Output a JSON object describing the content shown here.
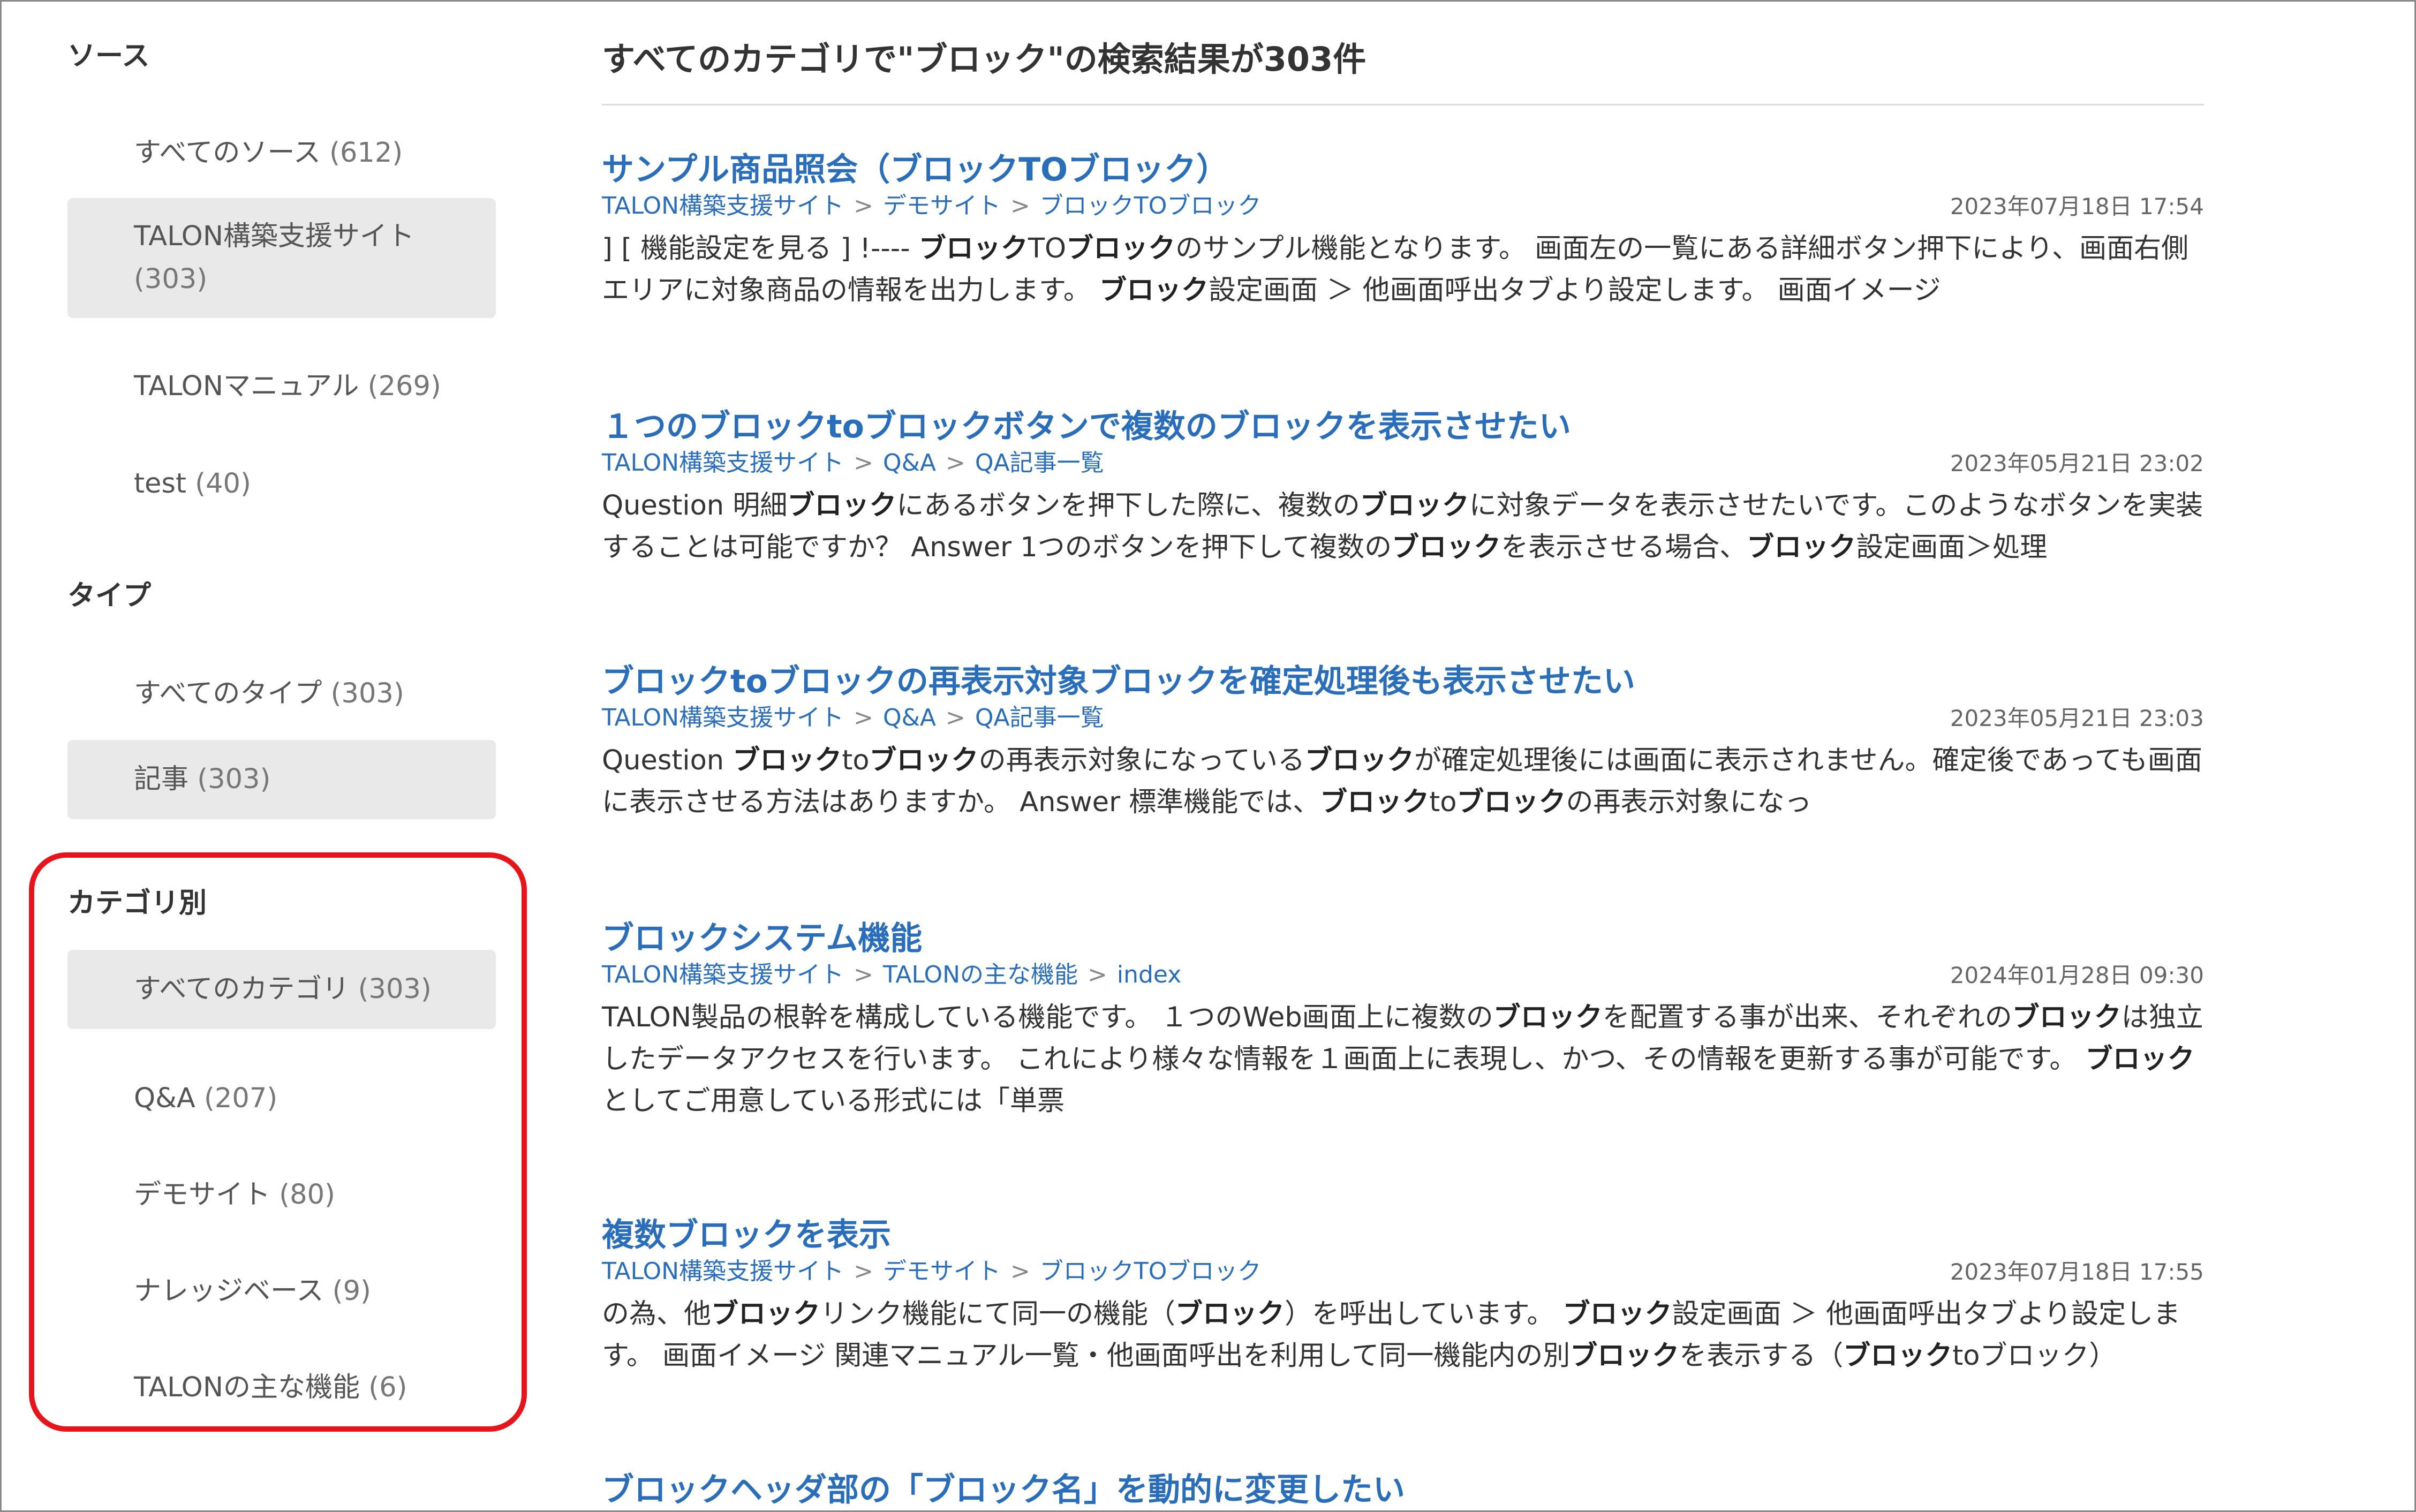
{
  "sidebar": {
    "source": {
      "heading": "ソース",
      "items": [
        {
          "label": "すべてのソース",
          "count": "(612)"
        },
        {
          "label": "TALON構築支援サイト",
          "count": "(303)"
        },
        {
          "label": "TALONマニュアル",
          "count": "(269)"
        },
        {
          "label": "test",
          "count": "(40)"
        }
      ]
    },
    "type": {
      "heading": "タイプ",
      "items": [
        {
          "label": "すべてのタイプ",
          "count": "(303)"
        },
        {
          "label": "記事",
          "count": "(303)"
        }
      ]
    },
    "category": {
      "heading": "カテゴリ別",
      "items": [
        {
          "label": "すべてのカテゴリ",
          "count": "(303)"
        },
        {
          "label": "Q&A",
          "count": "(207)"
        },
        {
          "label": "デモサイト",
          "count": "(80)"
        },
        {
          "label": "ナレッジベース",
          "count": "(9)"
        },
        {
          "label": "TALONの主な機能",
          "count": "(6)"
        }
      ]
    }
  },
  "main": {
    "header": "すべてのカテゴリで\"ブロック\"の検索結果が303件",
    "results": [
      {
        "title": "サンプル商品照会（ブロックTOブロック）",
        "breadcrumb": [
          "TALON構築支援サイト",
          "デモサイト",
          "ブロックTOブロック"
        ],
        "date": "2023年07月18日 17:54",
        "snippet": [
          {
            "t": "] [ 機能設定を見る ] !---- "
          },
          {
            "t": "ブロック",
            "b": true
          },
          {
            "t": "TO"
          },
          {
            "t": "ブロック",
            "b": true
          },
          {
            "t": "のサンプル機能となります。 画面左の一覧にある詳細ボタン押下により、画面右側エリアに対象商品の情報を出力します。 "
          },
          {
            "t": "ブロック",
            "b": true
          },
          {
            "t": "設定画面 ＞ 他画面呼出タブより設定します。 画面イメージ"
          }
        ]
      },
      {
        "title": "１つのブロックtoブロックボタンで複数のブロックを表示させたい",
        "breadcrumb": [
          "TALON構築支援サイト",
          "Q&A",
          "QA記事一覧"
        ],
        "date": "2023年05月21日 23:02",
        "snippet": [
          {
            "t": "Question 明細"
          },
          {
            "t": "ブロック",
            "b": true
          },
          {
            "t": "にあるボタンを押下した際に、複数の"
          },
          {
            "t": "ブロック",
            "b": true
          },
          {
            "t": "に対象データを表示させたいです。このようなボタンを実装することは可能ですか？ Answer 1つのボタンを押下して複数の"
          },
          {
            "t": "ブロック",
            "b": true
          },
          {
            "t": "を表示させる場合、"
          },
          {
            "t": "ブロック",
            "b": true
          },
          {
            "t": "設定画面＞処理"
          }
        ]
      },
      {
        "title": "ブロックtoブロックの再表示対象ブロックを確定処理後も表示させたい",
        "breadcrumb": [
          "TALON構築支援サイト",
          "Q&A",
          "QA記事一覧"
        ],
        "date": "2023年05月21日 23:03",
        "snippet": [
          {
            "t": "Question "
          },
          {
            "t": "ブロック",
            "b": true
          },
          {
            "t": "to"
          },
          {
            "t": "ブロック",
            "b": true
          },
          {
            "t": "の再表示対象になっている"
          },
          {
            "t": "ブロック",
            "b": true
          },
          {
            "t": "が確定処理後には画面に表示されません。確定後であっても画面に表示させる方法はありますか。 Answer 標準機能では、"
          },
          {
            "t": "ブロック",
            "b": true
          },
          {
            "t": "to"
          },
          {
            "t": "ブロック",
            "b": true
          },
          {
            "t": "の再表示対象になっ"
          }
        ]
      },
      {
        "title": "ブロックシステム機能",
        "breadcrumb": [
          "TALON構築支援サイト",
          "TALONの主な機能",
          "index"
        ],
        "date": "2024年01月28日 09:30",
        "snippet": [
          {
            "t": "TALON製品の根幹を構成している機能です。 １つのWeb画面上に複数の"
          },
          {
            "t": "ブロック",
            "b": true
          },
          {
            "t": "を配置する事が出来、それぞれの"
          },
          {
            "t": "ブロック",
            "b": true
          },
          {
            "t": "は独立したデータアクセスを行います。 これにより様々な情報を１画面上に表現し、かつ、その情報を更新する事が可能です。 "
          },
          {
            "t": "ブロック",
            "b": true
          },
          {
            "t": "としてご用意している形式には「単票"
          }
        ]
      },
      {
        "title": "複数ブロックを表示",
        "breadcrumb": [
          "TALON構築支援サイト",
          "デモサイト",
          "ブロックTOブロック"
        ],
        "date": "2023年07月18日 17:55",
        "snippet": [
          {
            "t": "の為、他"
          },
          {
            "t": "ブロック",
            "b": true
          },
          {
            "t": "リンク機能にて同一の機能（"
          },
          {
            "t": "ブロック",
            "b": true
          },
          {
            "t": "）を呼出しています。 "
          },
          {
            "t": "ブロック",
            "b": true
          },
          {
            "t": "設定画面 ＞ 他画面呼出タブより設定します。 画面イメージ 関連マニュアル一覧・他画面呼出を利用して同一機能内の別"
          },
          {
            "t": "ブロック",
            "b": true
          },
          {
            "t": "を表示する（"
          },
          {
            "t": "ブロック",
            "b": true
          },
          {
            "t": "to"
          },
          {
            "t": "ブロック"
          },
          {
            "t": "）"
          }
        ]
      },
      {
        "title": "ブロックヘッダ部の「ブロック名」を動的に変更したい",
        "breadcrumb": [],
        "date": "",
        "snippet": []
      }
    ]
  },
  "colors": {
    "link": "#2a6ebb",
    "selected_bg": "#e9e9ea",
    "highlight_border": "#e8141b"
  }
}
